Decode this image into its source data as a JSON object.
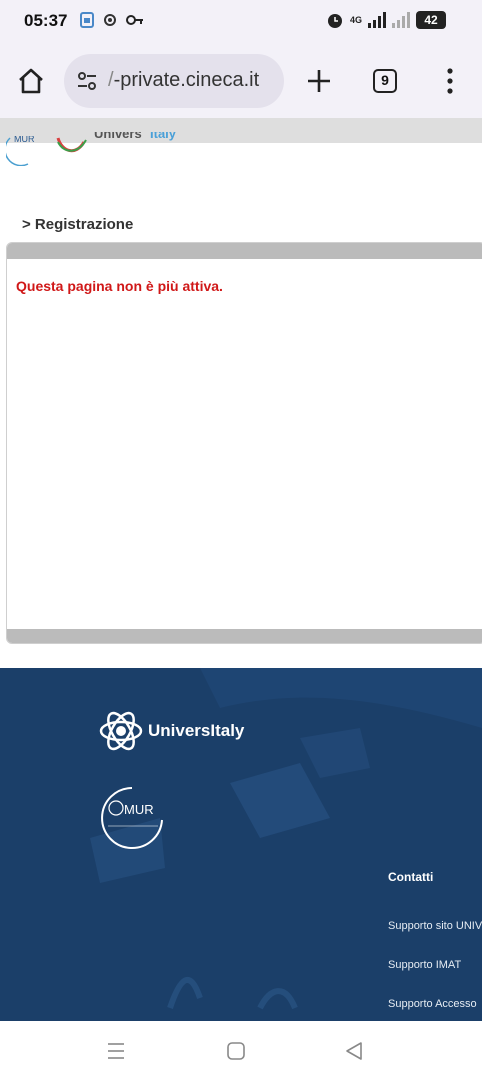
{
  "status_bar": {
    "time": "05:37",
    "network": "4G",
    "battery": "42",
    "icons": [
      "gallery-icon",
      "settings-icon",
      "key-icon",
      "alarm-icon",
      "signal-icon",
      "battery-icon"
    ]
  },
  "browser": {
    "home_icon": "home-icon",
    "url_prefix": "/",
    "url": "-private.cineca.it",
    "tabs_count": "9",
    "new_tab_icon": "plus-icon",
    "menu_icon": "more-vertical-icon"
  },
  "page": {
    "header_logo_partial": "UniversItaly",
    "header_mur_partial": "MUR",
    "breadcrumb": "> Registrazione",
    "message": "Questa pagina non è più attiva.",
    "message_color": "#d01818"
  },
  "footer": {
    "brand": "UniversItaly",
    "mur_label": "MUR",
    "contacts_title": "Contatti",
    "links": [
      "Supporto sito UNIV",
      "Supporto IMAT",
      "Supporto Accesso"
    ],
    "background": "#1b3f69"
  },
  "nav": {
    "items": [
      "recents-icon",
      "home-icon",
      "back-icon"
    ]
  }
}
